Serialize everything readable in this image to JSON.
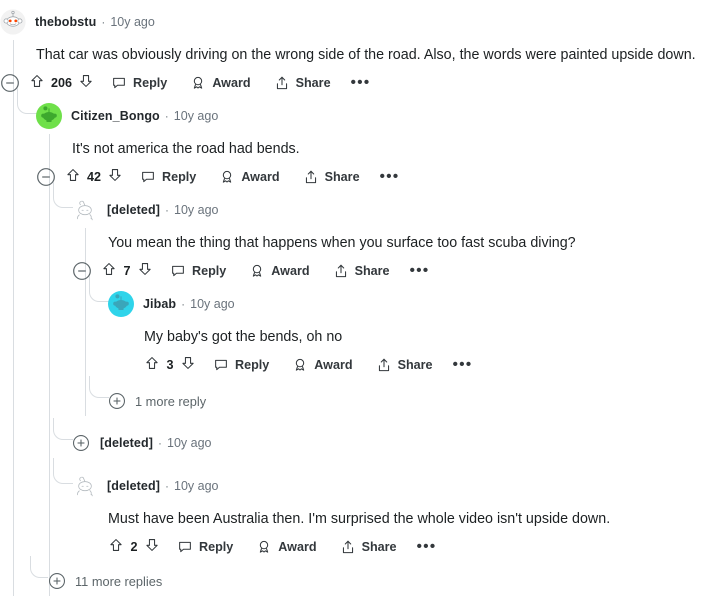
{
  "meta": {
    "platform": "reddit-comment-thread",
    "colors": {
      "text": "#1c2022",
      "username": "#23282c",
      "muted": "#6a737c",
      "rail": "#d9dde1",
      "avatar_green_bg": "#6fe04a",
      "avatar_green_fg": "#3da82e",
      "avatar_cyan_bg": "#2fd4ea",
      "avatar_cyan_fg": "#3aa6ba"
    }
  },
  "actions": {
    "reply": "Reply",
    "award": "Award",
    "share": "Share",
    "overflow": "•••",
    "separator": "·"
  },
  "comments": [
    {
      "id": "c1",
      "username": "thebobstu",
      "timestamp": "10y ago",
      "avatar": "snoo-default",
      "body": "That car was obviously driving on the wrong side of the road. Also, the words were painted upside down.",
      "score": "206",
      "collapsible": true,
      "has_overflow": true
    },
    {
      "id": "c2",
      "username": "Citizen_Bongo",
      "timestamp": "10y ago",
      "avatar": "snoo-green",
      "body": "It's not america the road had bends.",
      "score": "42",
      "collapsible": true,
      "has_overflow": true
    },
    {
      "id": "c3",
      "username": "[deleted]",
      "timestamp": "10y ago",
      "avatar": "snoo-deleted",
      "body": "You mean the thing that happens when you surface too fast scuba diving?",
      "score": "7",
      "collapsible": true,
      "has_overflow": true
    },
    {
      "id": "c4",
      "username": "Jibab",
      "timestamp": "10y ago",
      "avatar": "snoo-cyan",
      "body": "My baby's got the bends, oh no",
      "score": "3",
      "collapsible": false,
      "has_overflow": true
    },
    {
      "id": "c5",
      "username": "[deleted]",
      "timestamp": "10y ago",
      "avatar": "none",
      "collapsed": true
    },
    {
      "id": "c6",
      "username": "[deleted]",
      "timestamp": "10y ago",
      "avatar": "snoo-deleted",
      "body": "Must have been Australia then. I'm surprised the whole video isn't upside down.",
      "score": "2",
      "collapsible": false,
      "has_overflow": true
    }
  ],
  "more_links": [
    {
      "id": "m1",
      "label": "1 more reply"
    },
    {
      "id": "m2",
      "label": "11 more replies"
    }
  ]
}
